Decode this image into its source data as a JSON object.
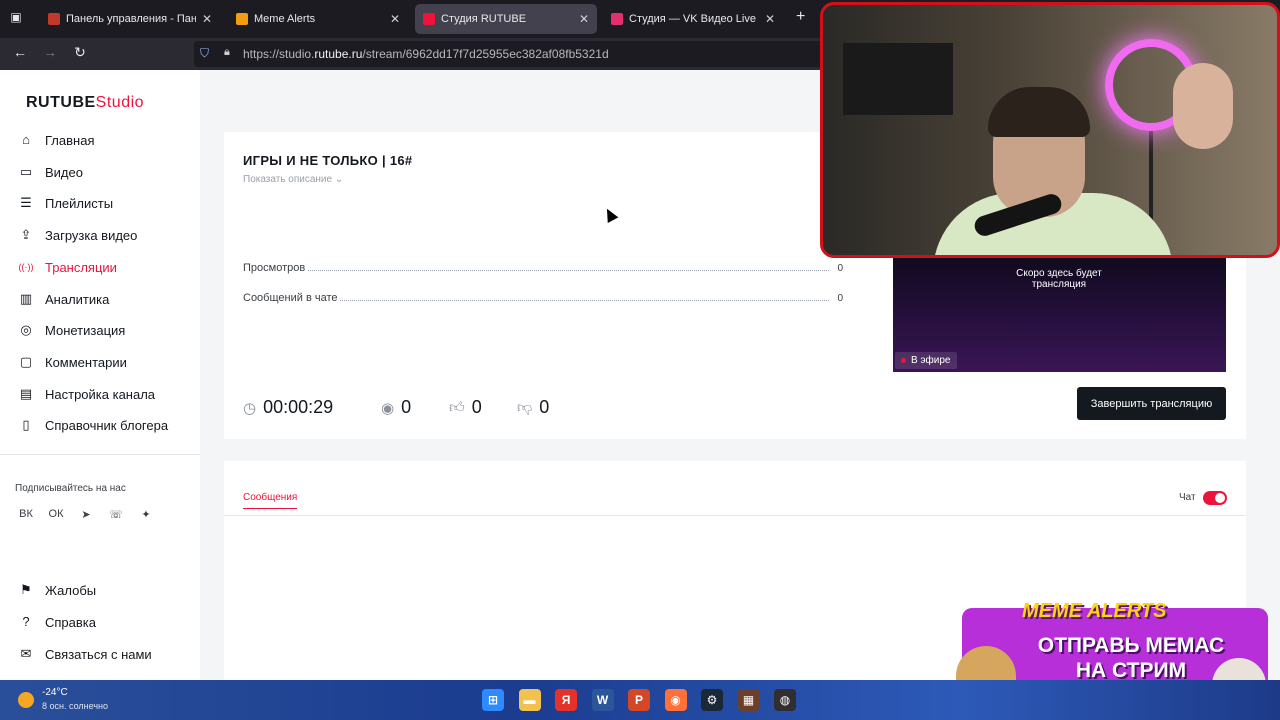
{
  "browser": {
    "tabs": [
      {
        "title": "Панель управления - Панель у",
        "fav_color": "#c0392b"
      },
      {
        "title": "Meme Alerts",
        "fav_color": "#f39c12"
      },
      {
        "title": "Студия RUTUBE",
        "fav_color": "#ed143b",
        "active": true
      },
      {
        "title": "Студия — VK Видео Live",
        "fav_color": "#e1306c"
      }
    ],
    "url_prefix": "https://studio.",
    "url_domain": "rutube.ru",
    "url_path": "/stream/6962dd17f7d25955ec382af08fb5321d"
  },
  "sidebar": {
    "logo_main": "RUTUBE",
    "logo_studio": "Studio",
    "items": [
      {
        "label": "Главная",
        "icon": "⌂"
      },
      {
        "label": "Видео",
        "icon": "▭"
      },
      {
        "label": "Плейлисты",
        "icon": "☰"
      },
      {
        "label": "Загрузка видео",
        "icon": "⇪"
      },
      {
        "label": "Трансляции",
        "icon": "((·))",
        "active": true
      },
      {
        "label": "Аналитика",
        "icon": "▥"
      },
      {
        "label": "Монетизация",
        "icon": "◎"
      },
      {
        "label": "Комментарии",
        "icon": "▢"
      },
      {
        "label": "Настройка канала",
        "icon": "▤"
      },
      {
        "label": "Справочник блогера",
        "icon": "▯"
      }
    ],
    "subscribe_label": "Подписывайтесь на нас",
    "socials": [
      "ВК",
      "ОК",
      "➤",
      "☏",
      "✦"
    ],
    "bottom_items": [
      {
        "label": "Жалобы",
        "icon": "⚑"
      },
      {
        "label": "Справка",
        "icon": "?"
      },
      {
        "label": "Связаться с нами",
        "icon": "✉"
      }
    ]
  },
  "stream": {
    "title": "ИГРЫ И НЕ ТОЛЬКО | 16#",
    "show_description": "Показать описание",
    "stats": [
      {
        "label": "Просмотров",
        "value": "0"
      },
      {
        "label": "Сообщений в чате",
        "value": "0"
      }
    ],
    "duration": "00:00:29",
    "viewers": "0",
    "likes": "0",
    "dislikes": "0",
    "preview_text": "Скоро здесь будет трансляция",
    "live_badge": "В эфире",
    "end_button": "Завершить трансляцию"
  },
  "chat": {
    "tab_label": "Сообщения",
    "toggle_label": "Чат",
    "toggle_on": true
  },
  "overlay": {
    "meme_brand": "MEME ALERTS",
    "meme_line1": "ОТПРАВЬ МЕМАС",
    "meme_line2": "НА СТРИМ"
  },
  "taskbar": {
    "temperature": "-24°C",
    "weather": "8 осн. солнечно",
    "apps": [
      {
        "name": "windows-start-icon",
        "glyph": "⊞",
        "color": "#2e8bff"
      },
      {
        "name": "file-explorer-icon",
        "glyph": "▬",
        "color": "#f2c14e"
      },
      {
        "name": "yandex-browser-icon",
        "glyph": "Я",
        "color": "#e4322b"
      },
      {
        "name": "word-icon",
        "glyph": "W",
        "color": "#2b579a"
      },
      {
        "name": "powerpoint-icon",
        "glyph": "P",
        "color": "#d24726"
      },
      {
        "name": "firefox-icon",
        "glyph": "◉",
        "color": "#ff7139"
      },
      {
        "name": "steam-icon",
        "glyph": "⚙",
        "color": "#1b2838"
      },
      {
        "name": "game-app-icon",
        "glyph": "▦",
        "color": "#6b3f2a"
      },
      {
        "name": "obs-icon",
        "glyph": "◍",
        "color": "#302e31"
      }
    ]
  }
}
